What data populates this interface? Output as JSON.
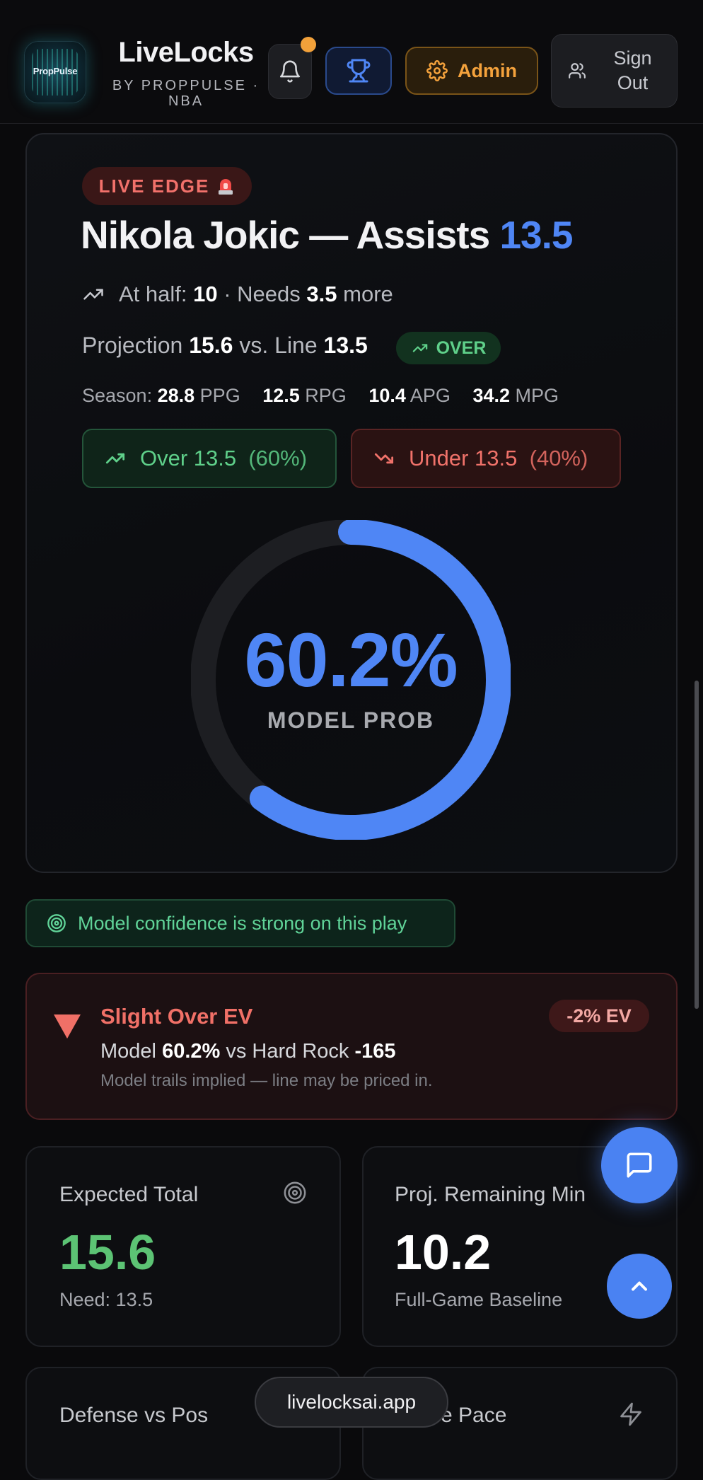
{
  "header": {
    "logo_text": "PropPulse",
    "title": "LiveLocks",
    "subtitle": "BY PROPPULSE · NBA",
    "admin_label": "Admin",
    "signout_label": "Sign Out"
  },
  "card": {
    "badge": "LIVE EDGE",
    "player_stat": "Nikola Jokic — Assists",
    "line": "13.5",
    "half_label": "At half:",
    "half_value": "10",
    "needs_label": "· Needs",
    "needs_value": "3.5",
    "needs_suffix": "more",
    "projection_label": "Projection",
    "projection_value": "15.6",
    "vs_label": "vs. Line",
    "line_value": "13.5",
    "pick_badge": "OVER",
    "season": {
      "label": "Season:",
      "stats": [
        {
          "value": "28.8",
          "unit": "PPG"
        },
        {
          "value": "12.5",
          "unit": "RPG"
        },
        {
          "value": "10.4",
          "unit": "APG"
        },
        {
          "value": "34.2",
          "unit": "MPG"
        }
      ]
    },
    "over_btn": {
      "label": "Over 13.5",
      "pct": "(60%)"
    },
    "under_btn": {
      "label": "Under 13.5",
      "pct": "(40%)"
    },
    "gauge": {
      "value_text": "60.2%",
      "fraction": 0.602,
      "label": "MODEL PROB"
    }
  },
  "confidence": "Model confidence is strong on this play",
  "ev": {
    "title": "Slight Over EV",
    "badge": "-2% EV",
    "model_label": "Model",
    "model_value": "60.2%",
    "book_label": "vs Hard Rock",
    "book_odds": "-165",
    "note": "Model trails implied — line may be priced in."
  },
  "stats": [
    {
      "label": "Expected Total",
      "value": "15.6",
      "sub": "Need: 13.5"
    },
    {
      "label": "Proj. Remaining Min",
      "value": "10.2",
      "sub": "Full-Game Baseline"
    },
    {
      "label": "Defense vs Pos"
    },
    {
      "label": "Game Pace"
    }
  ],
  "domain": "livelocksai.app",
  "colors": {
    "accent_blue": "#4f86f5",
    "green": "#5fd08a",
    "red": "#f07067",
    "admin_orange": "#f4a23c"
  }
}
